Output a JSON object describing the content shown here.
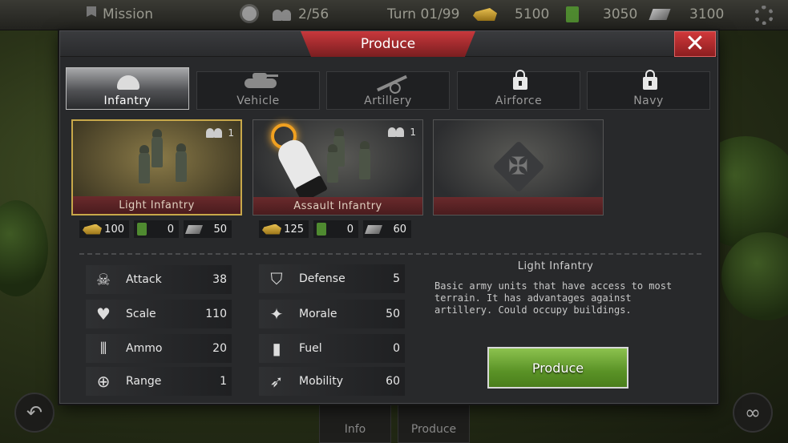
{
  "topbar": {
    "mission_label": "Mission",
    "population": "2/56",
    "turn": "Turn 01/99",
    "gold": "5100",
    "oil": "3050",
    "steel": "3100"
  },
  "bottom_tabs": [
    {
      "label": "Info"
    },
    {
      "label": "Produce"
    }
  ],
  "dialog": {
    "title": "Produce",
    "close_label": "✕",
    "tabs": [
      {
        "label": "Infantry",
        "icon": "helmet-icon",
        "locked": false,
        "active": true
      },
      {
        "label": "Vehicle",
        "icon": "tank-icon",
        "locked": false,
        "active": false
      },
      {
        "label": "Artillery",
        "icon": "artillery-icon",
        "locked": false,
        "active": false
      },
      {
        "label": "Airforce",
        "icon": "lock-icon",
        "locked": true,
        "active": false
      },
      {
        "label": "Navy",
        "icon": "lock-icon",
        "locked": true,
        "active": false
      }
    ],
    "units": [
      {
        "name": "Light Infantry",
        "count": "1",
        "gold": "100",
        "oil": "0",
        "steel": "50",
        "selected": true
      },
      {
        "name": "Assault Infantry",
        "count": "1",
        "gold": "125",
        "oil": "0",
        "steel": "60",
        "selected": false
      },
      {
        "name": "",
        "empty": true,
        "icon": "iron-cross-icon"
      }
    ],
    "stats_left": [
      {
        "label": "Attack",
        "value": "38",
        "icon": "skull-icon"
      },
      {
        "label": "Scale",
        "value": "110",
        "icon": "heart-icon"
      },
      {
        "label": "Ammo",
        "value": "20",
        "icon": "ammo-icon"
      },
      {
        "label": "Range",
        "value": "1",
        "icon": "crosshair-icon"
      }
    ],
    "stats_right": [
      {
        "label": "Defense",
        "value": "5",
        "icon": "shield-icon"
      },
      {
        "label": "Morale",
        "value": "50",
        "icon": "eagle-icon"
      },
      {
        "label": "Fuel",
        "value": "0",
        "icon": "fuel-can-icon"
      },
      {
        "label": "Mobility",
        "value": "60",
        "icon": "running-man-icon"
      }
    ],
    "description": {
      "title": "Light Infantry",
      "text": "Basic army units that have access to most terrain. It has advantages against artillery. Could occupy buildings."
    },
    "produce_label": "Produce"
  },
  "colors": {
    "accent_red": "#c8383c",
    "produce_green": "#6aa832",
    "selected_border": "#c8a84a"
  }
}
